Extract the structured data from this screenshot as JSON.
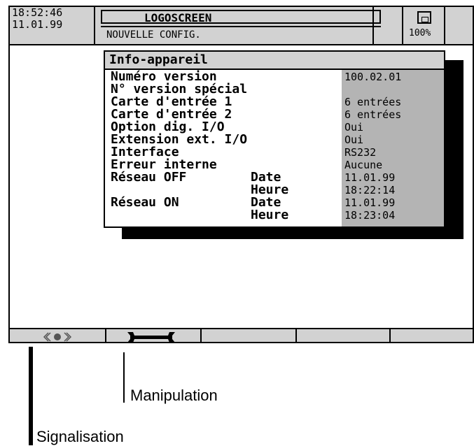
{
  "header": {
    "time": "18:52:46",
    "date": "11.01.99",
    "title": "LOGOSCREEN",
    "subtitle": "NOUVELLE CONFIG.",
    "zoom": "100%"
  },
  "dialog": {
    "title": "Info-appareil",
    "rows": [
      {
        "label": "Numéro version",
        "sub": "",
        "value": "100.02.01"
      },
      {
        "label": "N° version spécial",
        "sub": "",
        "value": ""
      },
      {
        "label": "Carte d'entrée 1",
        "sub": "",
        "value": "6 entrées"
      },
      {
        "label": "Carte d'entrée 2",
        "sub": "",
        "value": "6 entrées"
      },
      {
        "label": "Option dig. I/O",
        "sub": "",
        "value": "Oui"
      },
      {
        "label": "Extension ext. I/O",
        "sub": "",
        "value": "Oui"
      },
      {
        "label": "Interface",
        "sub": "",
        "value": "RS232"
      },
      {
        "label": "Erreur interne",
        "sub": "",
        "value": "Aucune"
      },
      {
        "label": "Réseau OFF",
        "sub": "Date",
        "value": "11.01.99"
      },
      {
        "label": "",
        "sub": "Heure",
        "value": "18:22:14"
      },
      {
        "label": "Réseau ON",
        "sub": "Date",
        "value": "11.01.99"
      },
      {
        "label": "",
        "sub": "Heure",
        "value": "18:23:04"
      }
    ]
  },
  "softkeys": {
    "icons": [
      "signal-lamp-icon",
      "wrench-icon"
    ]
  },
  "annotations": {
    "manipulation": "Manipulation",
    "signalisation": "Signalisation"
  }
}
